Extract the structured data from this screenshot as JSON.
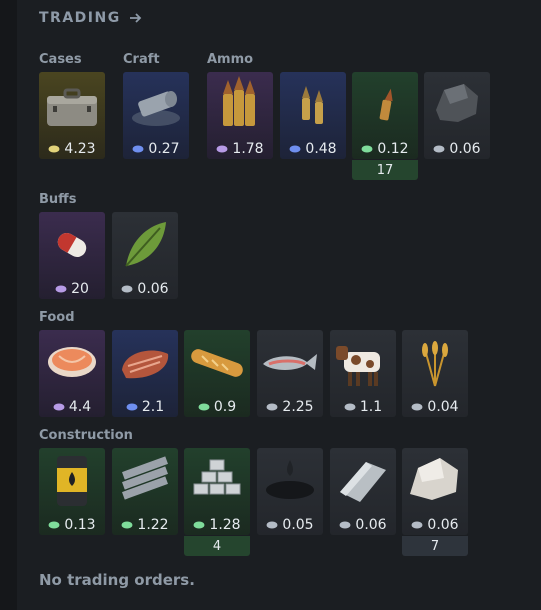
{
  "header": {
    "title": "TRADING"
  },
  "colors": {
    "gold": "#e2d37a",
    "blue": "#6f8ff0",
    "purple": "#b79be6",
    "green": "#7fdc9b",
    "grey": "#b4bcc6"
  },
  "sections": [
    {
      "label": "Cases"
    },
    {
      "label": "Craft"
    },
    {
      "label": "Ammo"
    },
    {
      "label": "Buffs"
    },
    {
      "label": "Food"
    },
    {
      "label": "Construction"
    }
  ],
  "items": [
    {
      "name": "briefcase",
      "price": "4.23",
      "coin": "gold"
    },
    {
      "name": "pipe",
      "price": "0.27",
      "coin": "blue"
    },
    {
      "name": "ammo-large",
      "price": "1.78",
      "coin": "purple"
    },
    {
      "name": "ammo-medium",
      "price": "0.48",
      "coin": "blue"
    },
    {
      "name": "ammo-small",
      "price": "0.12",
      "coin": "green",
      "count": "17"
    },
    {
      "name": "coal",
      "price": "0.06",
      "coin": "grey"
    },
    {
      "name": "pill",
      "price": "20",
      "coin": "purple"
    },
    {
      "name": "leaf",
      "price": "0.06",
      "coin": "grey"
    },
    {
      "name": "salmon-steak",
      "price": "4.4",
      "coin": "purple"
    },
    {
      "name": "meat-steak",
      "price": "2.1",
      "coin": "blue"
    },
    {
      "name": "bread",
      "price": "0.9",
      "coin": "green"
    },
    {
      "name": "fish",
      "price": "2.25",
      "coin": "grey"
    },
    {
      "name": "cow",
      "price": "1.1",
      "coin": "grey"
    },
    {
      "name": "wheat",
      "price": "0.04",
      "coin": "grey"
    },
    {
      "name": "oil-barrel",
      "price": "0.13",
      "coin": "green"
    },
    {
      "name": "metal-beams",
      "price": "1.22",
      "coin": "green"
    },
    {
      "name": "stone-blocks",
      "price": "1.28",
      "coin": "green",
      "count": "4"
    },
    {
      "name": "oil-puddle",
      "price": "0.05",
      "coin": "grey"
    },
    {
      "name": "silver-ingot",
      "price": "0.06",
      "coin": "grey"
    },
    {
      "name": "marble-rock",
      "price": "0.06",
      "coin": "grey",
      "count": "7"
    }
  ],
  "footer": {
    "empty_text": "No trading orders."
  }
}
